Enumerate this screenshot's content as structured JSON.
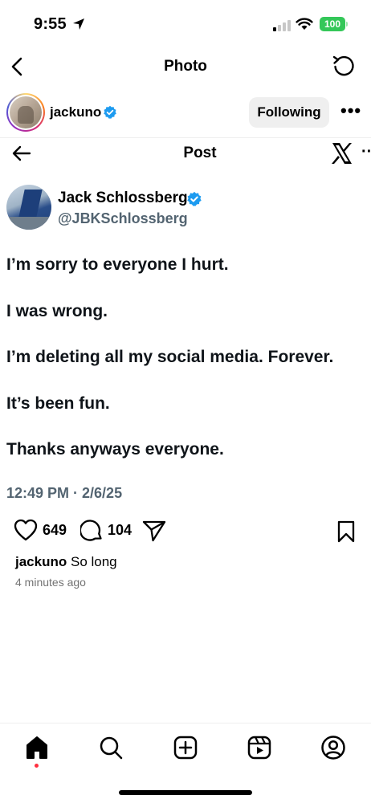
{
  "status_bar": {
    "time": "9:55",
    "battery": "100"
  },
  "nav": {
    "title": "Photo"
  },
  "author": {
    "username": "jackuno",
    "follow_label": "Following",
    "more": "•••"
  },
  "post_card": {
    "header_title": "Post",
    "display_name": "Jack Schlossberg",
    "handle": "@JBKSchlossberg",
    "lines": [
      "I’m sorry to everyone I hurt.",
      "I was wrong.",
      "I’m deleting all my social media. Forever.",
      "It’s been fun.",
      "Thanks anyways everyone."
    ],
    "timestamp": "12:49 PM · 2/6/25",
    "more": "··"
  },
  "actions": {
    "likes": "649",
    "comments": "104"
  },
  "caption": {
    "username": "jackuno",
    "text": "So long",
    "time_ago": "4 minutes ago"
  },
  "colors": {
    "verified": "#1d9bf0",
    "secondary_text": "#536471",
    "battery": "#34c759"
  }
}
